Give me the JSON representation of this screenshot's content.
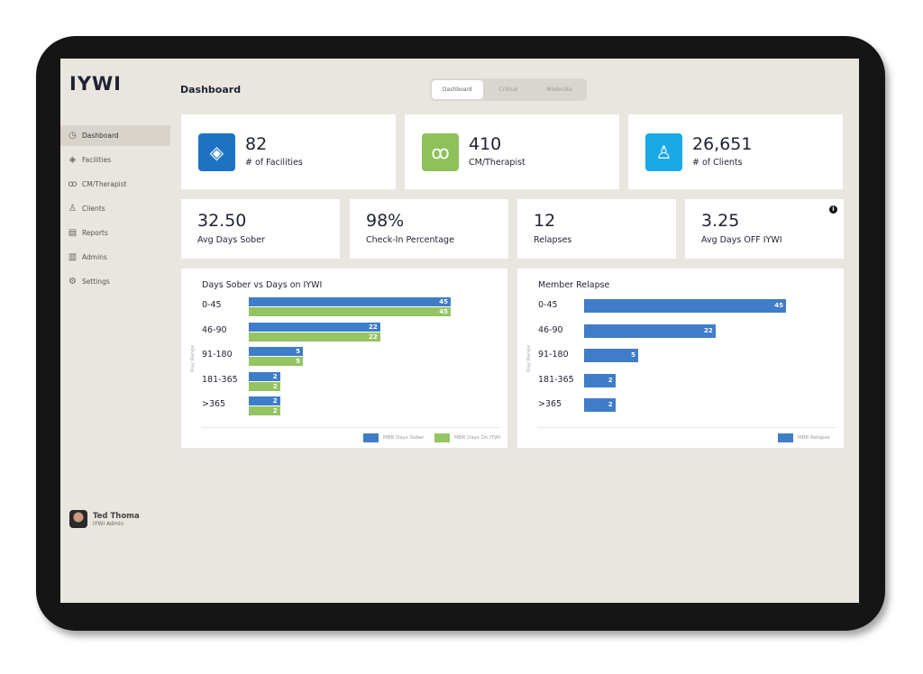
{
  "app": {
    "logo": "IYWI",
    "page_title": "Dashboard"
  },
  "tabs": [
    {
      "label": "Dashboard",
      "active": true
    },
    {
      "label": "Critical"
    },
    {
      "label": "Moderate"
    }
  ],
  "sidebar": {
    "items": [
      {
        "label": "Dashboard",
        "icon": "dashboard-gauge-icon",
        "active": true
      },
      {
        "label": "Facilities",
        "icon": "layers-icon"
      },
      {
        "label": "CM/Therapist",
        "icon": "users-icon"
      },
      {
        "label": "Clients",
        "icon": "user-icon"
      },
      {
        "label": "Reports",
        "icon": "reports-icon"
      },
      {
        "label": "Admins",
        "icon": "building-icon"
      },
      {
        "label": "Settings",
        "icon": "gear-icon"
      }
    ]
  },
  "user": {
    "name": "Ted Thoma",
    "role": "IYWI Admin"
  },
  "kpis": [
    {
      "value": "82",
      "label": "# of Facilities",
      "icon": "layers-icon",
      "color": "#1d72c4"
    },
    {
      "value": "410",
      "label": "CM/Therapist",
      "icon": "users-icon",
      "color": "#8fc15b"
    },
    {
      "value": "26,651",
      "label": "# of Clients",
      "icon": "user-icon",
      "color": "#1aa9e6"
    }
  ],
  "stats": [
    {
      "value": "32.50",
      "label": "Avg Days Sober"
    },
    {
      "value": "98%",
      "label": "Check-In Percentage"
    },
    {
      "value": "12",
      "label": "Relapses"
    },
    {
      "value": "3.25",
      "label": "Avg Days OFF IYWI",
      "info": "i"
    }
  ],
  "chart_data": [
    {
      "type": "bar",
      "orientation": "horizontal",
      "title": "Days Sober vs Days on IYWI",
      "ylabel": "Day Range",
      "categories": [
        "0-45",
        "46-90",
        "91-180",
        "181-365",
        ">365"
      ],
      "series": [
        {
          "name": "MBR Days Sober",
          "color": "#3f7dc9",
          "values": [
            45,
            22,
            5,
            2,
            2
          ]
        },
        {
          "name": "MBR Days On IYWI",
          "color": "#95c462",
          "values": [
            45,
            22,
            5,
            2,
            2
          ]
        }
      ],
      "legend": "bottom-right"
    },
    {
      "type": "bar",
      "orientation": "horizontal",
      "title": "Member Relapse",
      "ylabel": "Day Range",
      "categories": [
        "0-45",
        "46-90",
        "91-180",
        "181-365",
        ">365"
      ],
      "series": [
        {
          "name": "MBR Relapse",
          "color": "#3f7dc9",
          "values": [
            45,
            22,
            5,
            2,
            2
          ]
        }
      ],
      "legend": "bottom-right"
    }
  ]
}
